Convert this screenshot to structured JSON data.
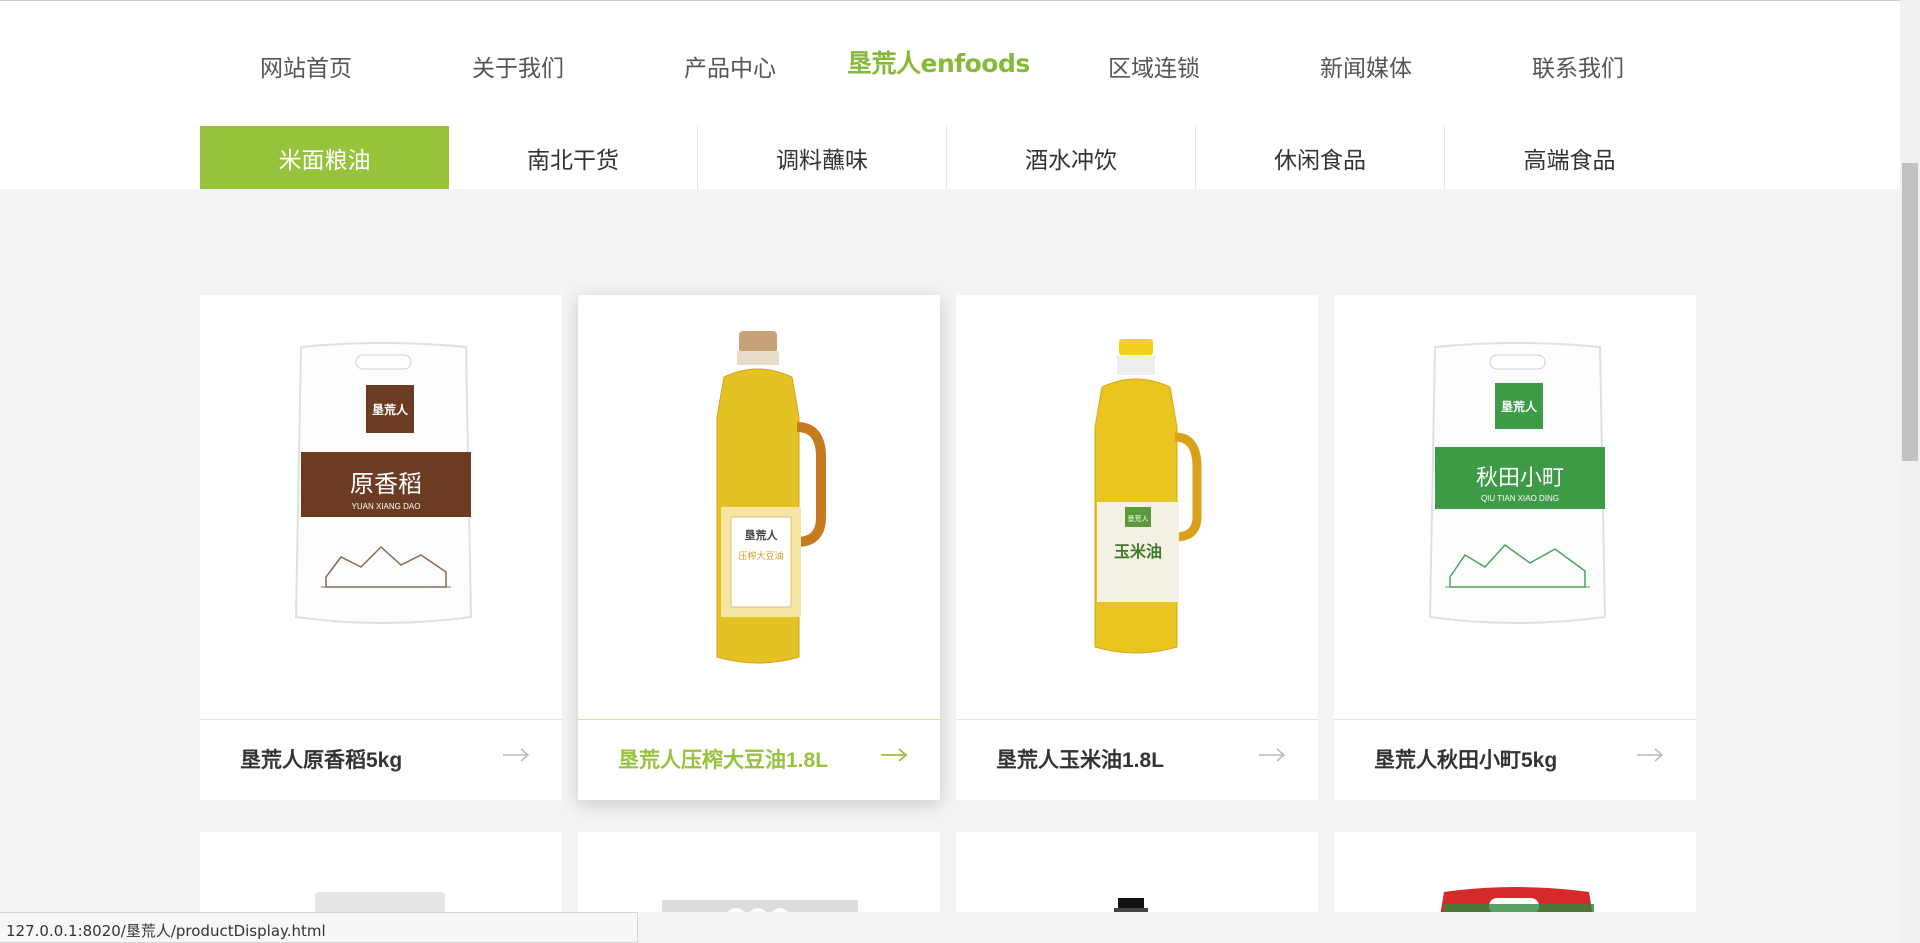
{
  "nav": {
    "items_left": [
      "网站首页",
      "关于我们",
      "产品中心"
    ],
    "logo_text": "垦荒人enfoods",
    "items_right": [
      "区域连锁",
      "新闻媒体",
      "联系我们"
    ]
  },
  "tabs": [
    {
      "label": "米面粮油",
      "active": true
    },
    {
      "label": "南北干货",
      "active": false
    },
    {
      "label": "调料蘸味",
      "active": false
    },
    {
      "label": "酒水冲饮",
      "active": false
    },
    {
      "label": "休闲食品",
      "active": false
    },
    {
      "label": "高端食品",
      "active": false
    }
  ],
  "products": [
    {
      "title": "垦荒人原香稻5kg",
      "highlighted": false,
      "icon": "rice-bag-brown",
      "bag_brand": "垦荒人",
      "bag_name": "原香稻",
      "bag_pinyin": "YUAN XIANG DAO"
    },
    {
      "title": "垦荒人压榨大豆油1.8L",
      "highlighted": true,
      "icon": "soybean-oil-bottle",
      "bag_brand": "垦荒人",
      "bag_name": "压榨大豆油"
    },
    {
      "title": "垦荒人玉米油1.8L",
      "highlighted": false,
      "icon": "corn-oil-bottle",
      "bag_brand": "垦荒人",
      "bag_name": "玉米油"
    },
    {
      "title": "垦荒人秋田小町5kg",
      "highlighted": false,
      "icon": "rice-bag-green",
      "bag_brand": "垦荒人",
      "bag_name": "秋田小町",
      "bag_pinyin": "QIU TIAN XIAO DING"
    }
  ],
  "status_url": "127.0.0.1:8020/垦荒人/productDisplay.html",
  "colors": {
    "accent": "#97c23c",
    "logo": "#86b93a"
  }
}
